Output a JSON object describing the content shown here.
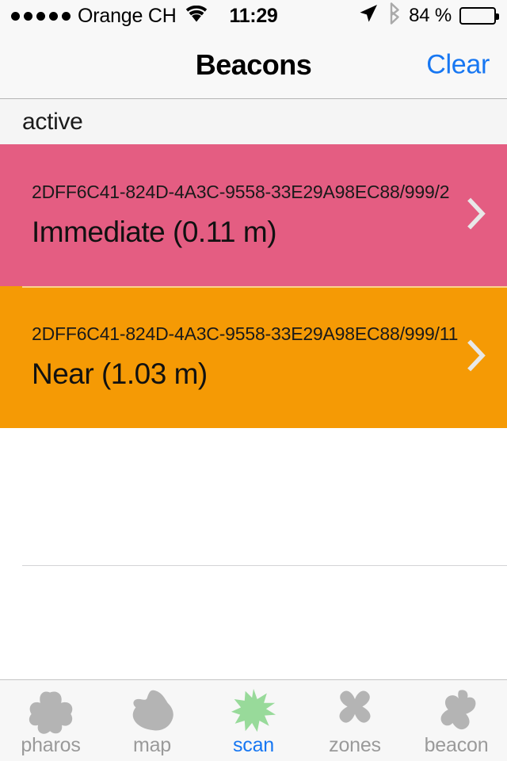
{
  "status_bar": {
    "signal_dots": 5,
    "signal_dots_filled": 5,
    "carrier": "Orange CH",
    "wifi_icon": "wifi-icon",
    "time": "11:29",
    "location_icon": "location-arrow-icon",
    "bluetooth_icon": "bluetooth-icon",
    "battery_text": "84 %",
    "battery_level_percent": 84
  },
  "nav_bar": {
    "title": "Beacons",
    "right_button_label": "Clear",
    "accent_color": "#1777f2"
  },
  "section": {
    "header": "active"
  },
  "beacons": [
    {
      "uuid": "2DFF6C41-824D-4A3C-9558-33E29A98EC88/999/2",
      "distance_label": "Immediate (0.11 m)",
      "proximity": "Immediate",
      "distance_meters": "0.11",
      "background_color": "#e45d82",
      "chevron_icon": "chevron-right-icon"
    },
    {
      "uuid": "2DFF6C41-824D-4A3C-9558-33E29A98EC88/999/11",
      "distance_label": "Near (1.03 m)",
      "proximity": "Near",
      "distance_meters": "1.03",
      "background_color": "#f59a05",
      "chevron_icon": "chevron-right-icon"
    }
  ],
  "tab_bar": {
    "active_index": 2,
    "active_color": "#1777f2",
    "active_icon_color": "#98da9a",
    "inactive_color": "#9a9a9a",
    "inactive_icon_color": "#b4b4b4",
    "items": [
      {
        "label": "pharos",
        "icon": "pharos-blob-icon"
      },
      {
        "label": "map",
        "icon": "map-blob-icon"
      },
      {
        "label": "scan",
        "icon": "scan-star-icon"
      },
      {
        "label": "zones",
        "icon": "zones-x-icon"
      },
      {
        "label": "beacon",
        "icon": "beacon-blob-icon"
      }
    ]
  }
}
